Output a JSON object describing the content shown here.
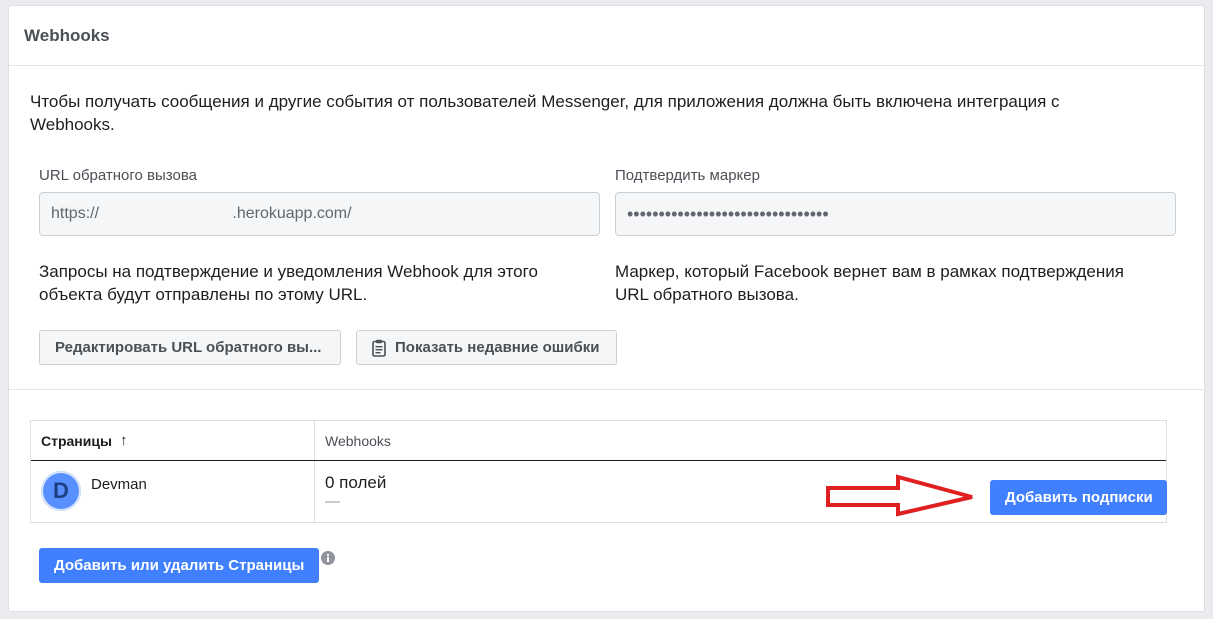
{
  "panel": {
    "title": "Webhooks"
  },
  "intro": "Чтобы получать сообщения и другие события от пользователей Messenger, для приложения должна быть включена интеграция с Webhooks.",
  "callback_url": {
    "label": "URL обратного вызова",
    "value": "https://                              .herokuapp.com/",
    "help": "Запросы на подтверждение и уведомления Webhook для этого объекта будут отправлены по этому URL."
  },
  "verify_token": {
    "label": "Подтвердить маркер",
    "value": "••••••••••••••••••••••••••••••••",
    "help": "Маркер, который Facebook вернет вам в рамках подтверждения URL обратного вызова."
  },
  "buttons": {
    "edit_callback": "Редактировать URL обратного вы...",
    "show_errors": "Показать недавние ошибки",
    "add_subscriptions": "Добавить подписки",
    "add_remove_pages": "Добавить или удалить Страницы"
  },
  "table": {
    "headers": {
      "pages": "Страницы",
      "sort_arrow": "↑",
      "webhooks": "Webhooks"
    },
    "rows": [
      {
        "avatar_letter": "D",
        "page_name": "Devman",
        "fields": "0 полей",
        "fields_detail": "—"
      }
    ]
  },
  "icons": {
    "clipboard": "clipboard-icon",
    "info": "info-icon",
    "arrow": "red-arrow-annotation"
  },
  "colors": {
    "primary": "#4080ff",
    "annotation_red": "#e02020",
    "panel_bg": "#ffffff",
    "page_bg": "#e9ebee"
  }
}
